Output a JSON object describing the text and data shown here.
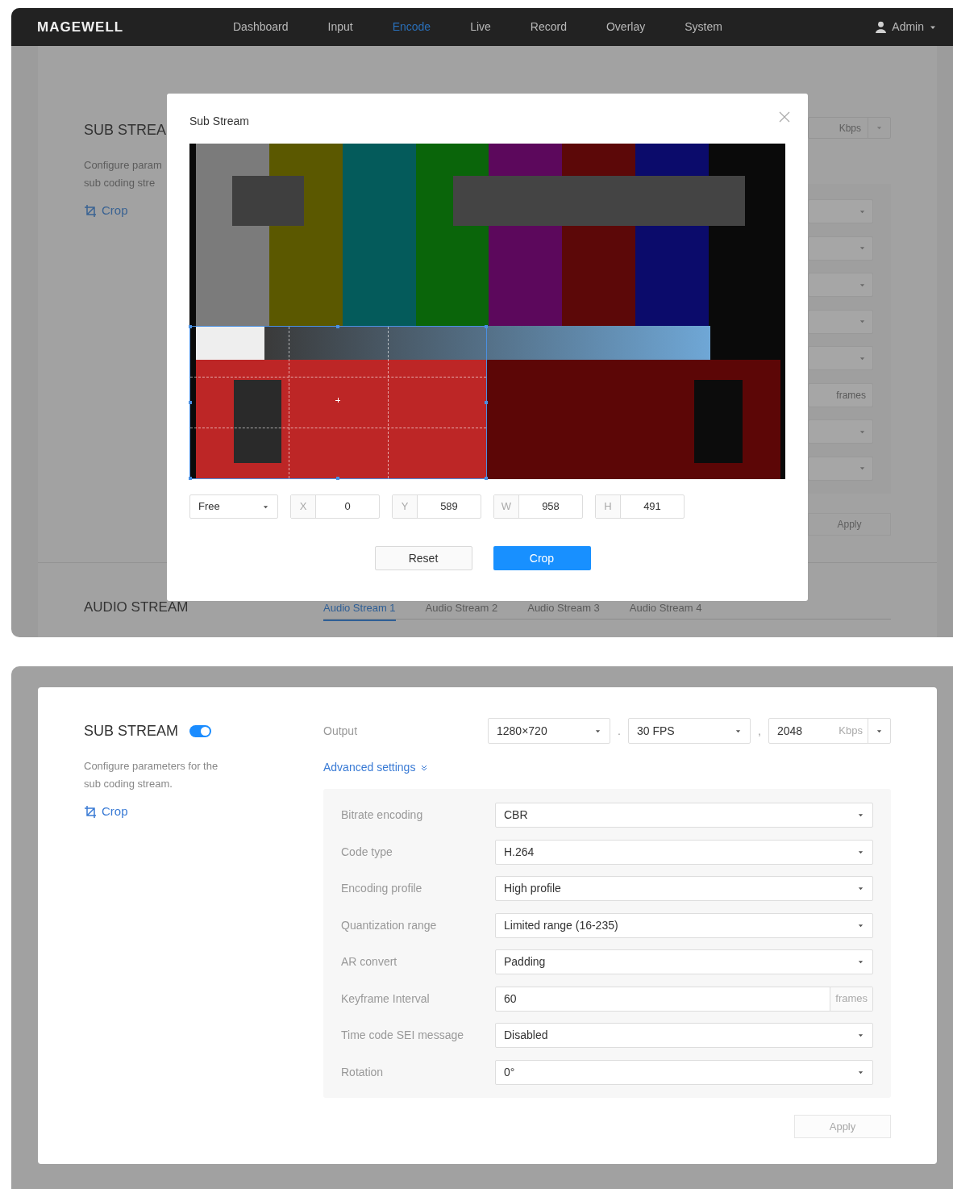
{
  "nav": {
    "logo": "MAGEWELL",
    "items": [
      {
        "label": "Dashboard",
        "selected": false
      },
      {
        "label": "Input",
        "selected": false
      },
      {
        "label": "Encode",
        "selected": true
      },
      {
        "label": "Live",
        "selected": false
      },
      {
        "label": "Record",
        "selected": false
      },
      {
        "label": "Overlay",
        "selected": false
      },
      {
        "label": "System",
        "selected": false
      }
    ],
    "user": "Admin"
  },
  "background": {
    "section_title": "SUB STREA",
    "description_lines": [
      "Configure param",
      "sub coding stre"
    ],
    "crop_link": "Crop",
    "bitrate_unit": "Kbps",
    "field_stubs": [
      {
        "kind": "select"
      },
      {
        "kind": "select"
      },
      {
        "kind": "select"
      },
      {
        "kind": "select"
      },
      {
        "kind": "select"
      },
      {
        "kind": "unit",
        "text": "frames"
      },
      {
        "kind": "select"
      },
      {
        "kind": "select"
      }
    ],
    "apply": "Apply",
    "audio_title": "AUDIO STREAM",
    "audio_tabs": [
      {
        "label": "Audio Stream 1",
        "selected": true
      },
      {
        "label": "Audio Stream 2",
        "selected": false
      },
      {
        "label": "Audio Stream 3",
        "selected": false
      },
      {
        "label": "Audio Stream 4",
        "selected": false
      }
    ]
  },
  "dialog": {
    "title": "Sub Stream",
    "aspect": "Free",
    "fields": [
      {
        "label": "X",
        "value": "0"
      },
      {
        "label": "Y",
        "value": "589"
      },
      {
        "label": "W",
        "value": "958"
      },
      {
        "label": "H",
        "value": "491"
      }
    ],
    "buttons": [
      {
        "label": "Reset",
        "kind": "default"
      },
      {
        "label": "Crop",
        "kind": "primary"
      }
    ]
  },
  "panel": {
    "title": "SUB STREAM",
    "enabled": true,
    "description": "Configure parameters for the sub coding stream.",
    "crop_link": "Crop",
    "output": {
      "label": "Output",
      "resolution": "1280×720",
      "separator_1": ".",
      "frame_rate": "30 FPS",
      "separator_2": ",",
      "bitrate": "2048",
      "bitrate_unit": "Kbps"
    },
    "advanced_link": "Advanced settings",
    "settings": [
      {
        "label": "Bitrate encoding",
        "value": "CBR",
        "kind": "select"
      },
      {
        "label": "Code type",
        "value": "H.264",
        "kind": "select"
      },
      {
        "label": "Encoding profile",
        "value": "High profile",
        "kind": "select"
      },
      {
        "label": "Quantization range",
        "value": "Limited range (16-235)",
        "kind": "select"
      },
      {
        "label": "AR convert",
        "value": "Padding",
        "kind": "select"
      },
      {
        "label": "Keyframe Interval",
        "value": "60",
        "kind": "input",
        "unit": "frames"
      },
      {
        "label": "Time code SEI message",
        "value": "Disabled",
        "kind": "select"
      },
      {
        "label": "Rotation",
        "value": "0°",
        "kind": "select"
      }
    ],
    "apply": {
      "label": "Apply",
      "disabled": true
    }
  }
}
